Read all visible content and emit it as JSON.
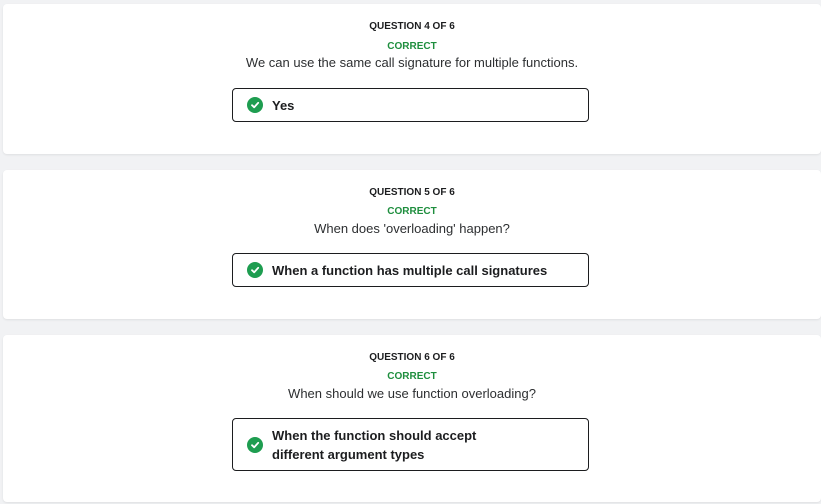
{
  "questions": [
    {
      "number_label": "QUESTION 4 OF 6",
      "status": "CORRECT",
      "prompt": "We can use the same call signature for multiple functions.",
      "answer": "Yes"
    },
    {
      "number_label": "QUESTION 5 OF 6",
      "status": "CORRECT",
      "prompt": "When does 'overloading' happen?",
      "answer": "When a function has multiple call signatures"
    },
    {
      "number_label": "QUESTION 6 OF 6",
      "status": "CORRECT",
      "prompt": "When should we use function overloading?",
      "answer": "When the function should accept different argument types"
    }
  ],
  "icons": {
    "answer_icon": "check-circle-icon"
  },
  "colors": {
    "correct": "#1e8e3e",
    "check_fill": "#1e9d50",
    "background": "#f1f2f4"
  }
}
